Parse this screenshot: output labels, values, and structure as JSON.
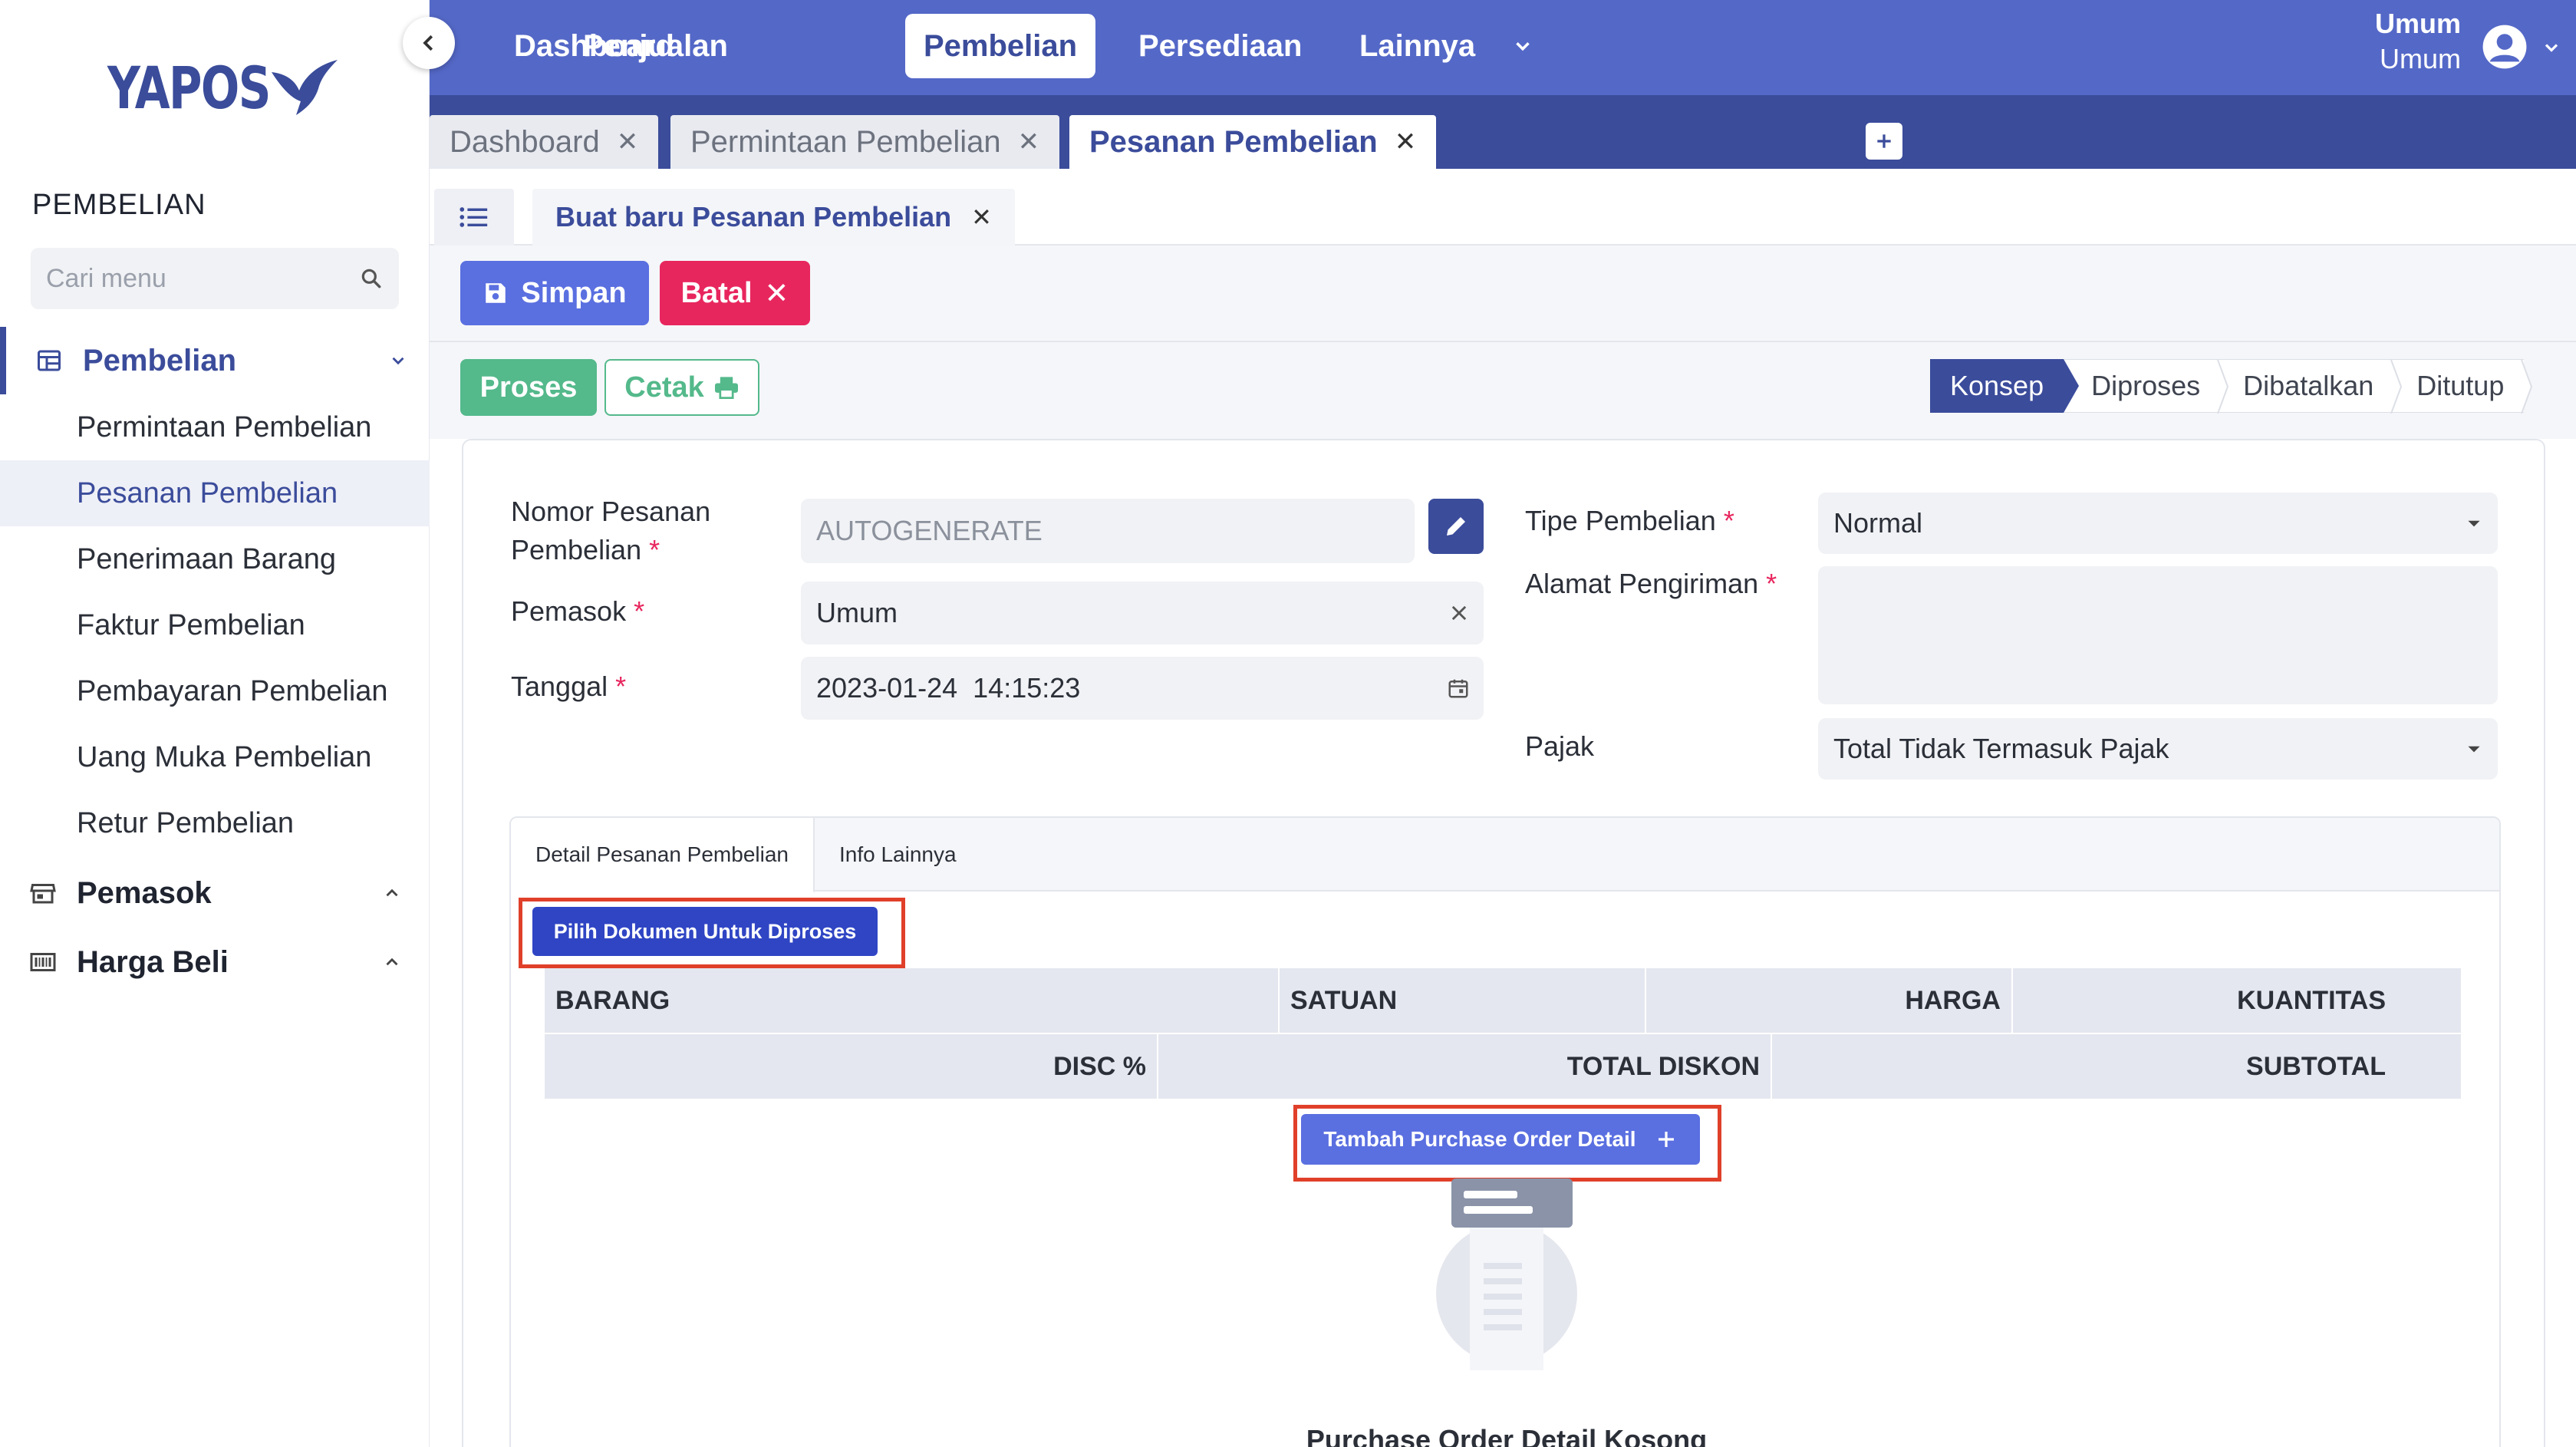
{
  "brand": {
    "name": "YAPOS"
  },
  "sidebar": {
    "section_title": "PEMBELIAN",
    "search_placeholder": "Cari menu",
    "groups": [
      {
        "label": "Pembelian",
        "icon": "table-icon",
        "expanded": true,
        "items": [
          {
            "label": "Permintaan Pembelian"
          },
          {
            "label": "Pesanan Pembelian",
            "active": true
          },
          {
            "label": "Penerimaan Barang"
          },
          {
            "label": "Faktur Pembelian"
          },
          {
            "label": "Pembayaran Pembelian"
          },
          {
            "label": "Uang Muka Pembelian"
          },
          {
            "label": "Retur Pembelian"
          }
        ]
      },
      {
        "label": "Pemasok",
        "icon": "store-icon",
        "expanded": false
      },
      {
        "label": "Harga Beli",
        "icon": "barcode-icon",
        "expanded": false
      }
    ]
  },
  "topnav": {
    "items": [
      "Dashboard",
      "Penjualan",
      "Pembelian",
      "Persediaan",
      "Lainnya"
    ],
    "active": "Pembelian",
    "user": {
      "name": "Umum",
      "role": "Umum"
    }
  },
  "page_tabs": [
    {
      "label": "Dashboard",
      "active": false
    },
    {
      "label": "Permintaan Pembelian",
      "active": false
    },
    {
      "label": "Pesanan Pembelian",
      "active": true
    }
  ],
  "doc_tab": {
    "label": "Buat baru Pesanan Pembelian"
  },
  "actions": {
    "save": "Simpan",
    "cancel": "Batal",
    "process": "Proses",
    "print": "Cetak"
  },
  "status_steps": [
    "Konsep",
    "Diproses",
    "Dibatalkan",
    "Ditutup"
  ],
  "status_active": "Konsep",
  "form": {
    "nomor_label_1": "Nomor Pesanan",
    "nomor_label_2": "Pembelian",
    "nomor_placeholder": "AUTOGENERATE",
    "pemasok_label": "Pemasok",
    "pemasok_value": "Umum",
    "tanggal_label": "Tanggal",
    "tanggal_value": "2023-01-24  14:15:23",
    "tipe_label": "Tipe Pembelian",
    "tipe_value": "Normal",
    "alamat_label": "Alamat Pengiriman",
    "alamat_value": "",
    "pajak_label": "Pajak",
    "pajak_value": "Total Tidak Termasuk Pajak",
    "required_mark": "*"
  },
  "detail": {
    "tabs": [
      "Detail Pesanan Pembelian",
      "Info Lainnya"
    ],
    "pick_button": "Pilih Dokumen Untuk Diproses",
    "header_row_1": [
      "BARANG",
      "SATUAN",
      "HARGA",
      "KUANTITAS"
    ],
    "header_row_2": [
      "DISC %",
      "TOTAL DISKON",
      "SUBTOTAL"
    ],
    "add_button": "Tambah Purchase Order Detail",
    "empty_text": "Purchase Order Detail Kosong"
  },
  "colors": {
    "primary": "#3b4c9b",
    "nav": "#5468c7",
    "accent_blue": "#5a6fe0",
    "danger": "#e8265e",
    "success": "#54b98b",
    "highlight": "#e0402a"
  }
}
